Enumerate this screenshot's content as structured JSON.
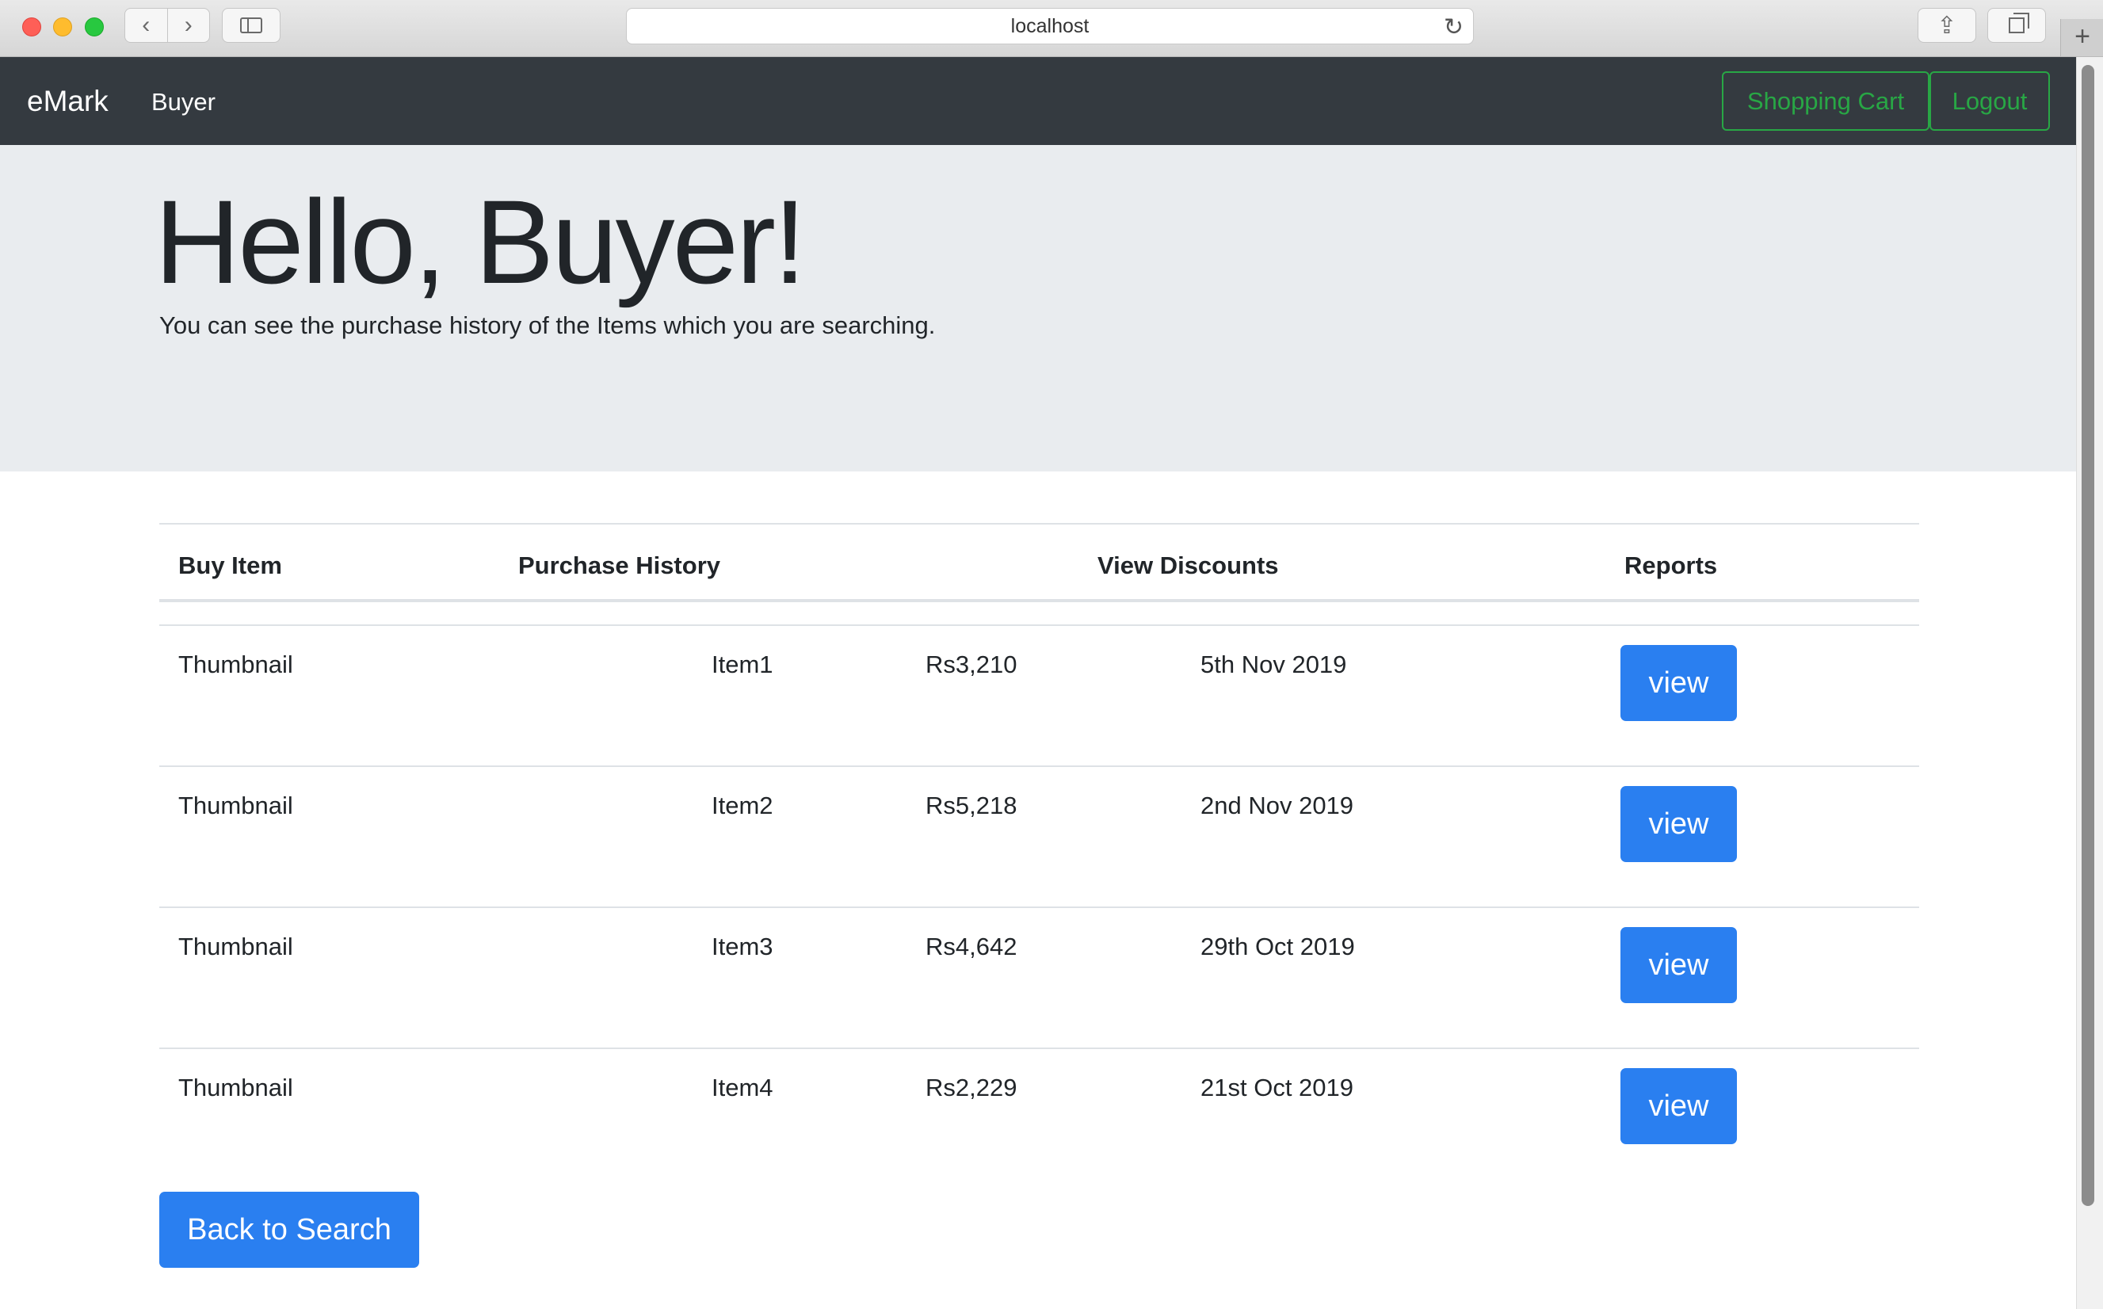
{
  "browser": {
    "url": "localhost",
    "back_glyph": "‹",
    "forward_glyph": "›",
    "reload_glyph": "↻",
    "share_glyph": "⇪",
    "newtab_glyph": "+"
  },
  "navbar": {
    "brand": "eMark",
    "nav_link": "Buyer",
    "cart_label": "Shopping Cart",
    "logout_label": "Logout",
    "accent_color": "#28a745"
  },
  "jumbotron": {
    "heading": "Hello, Buyer!",
    "lead": "You can see the purchase history of the Items which you are searching."
  },
  "table": {
    "headers": [
      "Buy Item",
      "Purchase History",
      "View Discounts",
      "Reports"
    ],
    "rows": [
      {
        "thumbnail": "Thumbnail",
        "item": "Item1",
        "price": "Rs3,210",
        "date": "5th Nov 2019",
        "action": "view"
      },
      {
        "thumbnail": "Thumbnail",
        "item": "Item2",
        "price": "Rs5,218",
        "date": "2nd Nov 2019",
        "action": "view"
      },
      {
        "thumbnail": "Thumbnail",
        "item": "Item3",
        "price": "Rs4,642",
        "date": "29th Oct 2019",
        "action": "view"
      },
      {
        "thumbnail": "Thumbnail",
        "item": "Item4",
        "price": "Rs2,229",
        "date": "21st Oct 2019",
        "action": "view"
      }
    ]
  },
  "footer_button": "Back to Search",
  "colors": {
    "primary": "#2a7ff0",
    "navbar_bg": "#343a40",
    "jumbotron_bg": "#e9ecef"
  }
}
